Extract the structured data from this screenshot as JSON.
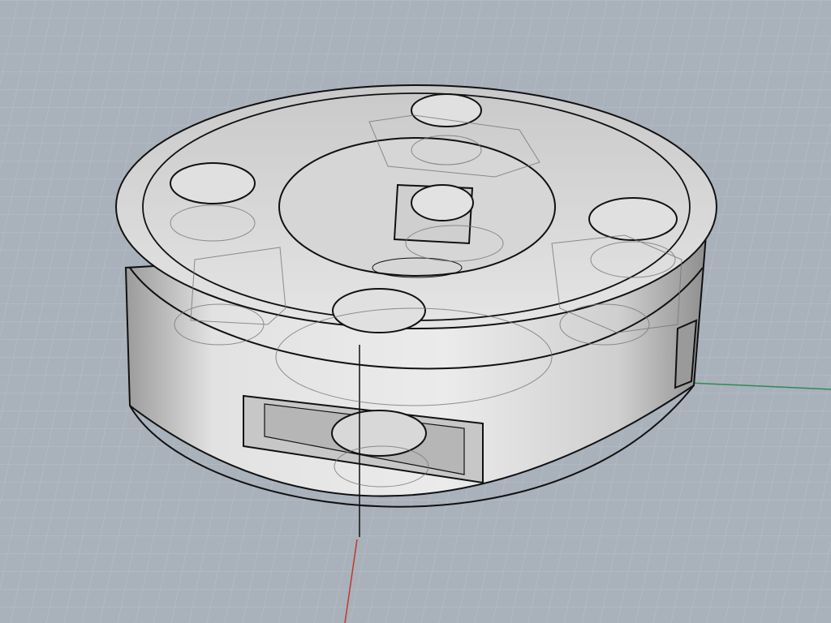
{
  "viewport": {
    "view": "perspective",
    "display_mode": "ghosted",
    "colors": {
      "background": "#a9b1bb",
      "grid_minor": "#bcc3cc",
      "grid_major": "#c8ced6",
      "part_fill": "#dcdcdc",
      "part_edge": "#111111",
      "x_axis": "#c0392b",
      "y_axis": "#2e8b57"
    }
  },
  "model": {
    "part": "cylindrical-hub",
    "features": [
      "center-bore",
      "outer-bolt-hole",
      "outer-bolt-hole",
      "outer-bolt-hole",
      "outer-bolt-hole",
      "hex-nut-pocket",
      "hex-nut-pocket",
      "hex-nut-pocket",
      "side-slot",
      "side-slot",
      "set-screw-hole"
    ]
  },
  "axes": {
    "x_axis_icon": "x-axis-line",
    "y_axis_icon": "y-axis-line"
  }
}
